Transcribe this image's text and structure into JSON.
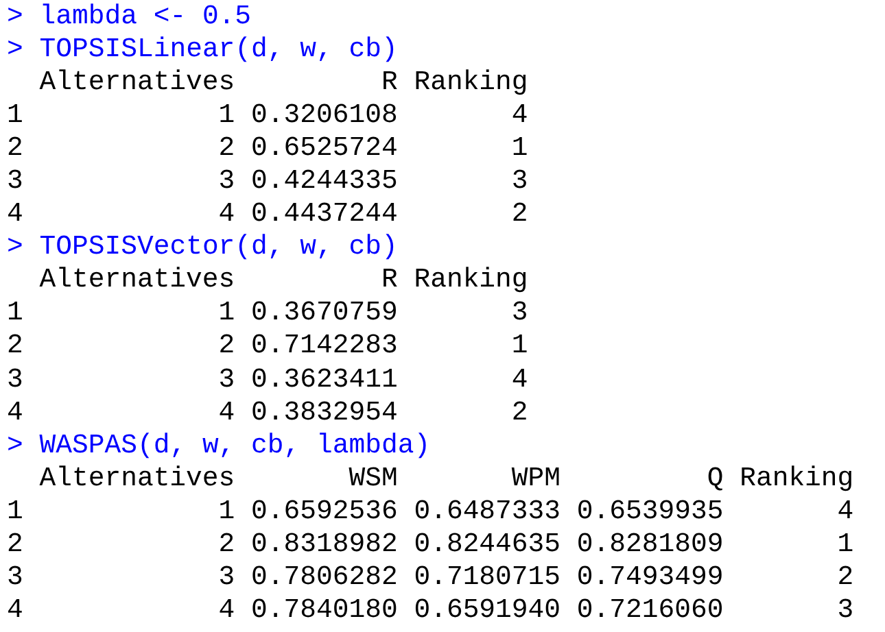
{
  "console": [
    {
      "kind": "command",
      "prompt": ">",
      "text": "lambda <- 0.5"
    },
    {
      "kind": "command",
      "prompt": ">",
      "text": "TOPSISLinear(d, w, cb)"
    },
    {
      "kind": "table",
      "columns": [
        "Alternatives",
        "R",
        "Ranking"
      ],
      "rows": [
        {
          "label": "1",
          "cells": [
            "1",
            "0.3206108",
            "4"
          ]
        },
        {
          "label": "2",
          "cells": [
            "2",
            "0.6525724",
            "1"
          ]
        },
        {
          "label": "3",
          "cells": [
            "3",
            "0.4244335",
            "3"
          ]
        },
        {
          "label": "4",
          "cells": [
            "4",
            "0.4437244",
            "2"
          ]
        }
      ]
    },
    {
      "kind": "command",
      "prompt": ">",
      "text": "TOPSISVector(d, w, cb)"
    },
    {
      "kind": "table",
      "columns": [
        "Alternatives",
        "R",
        "Ranking"
      ],
      "rows": [
        {
          "label": "1",
          "cells": [
            "1",
            "0.3670759",
            "3"
          ]
        },
        {
          "label": "2",
          "cells": [
            "2",
            "0.7142283",
            "1"
          ]
        },
        {
          "label": "3",
          "cells": [
            "3",
            "0.3623411",
            "4"
          ]
        },
        {
          "label": "4",
          "cells": [
            "4",
            "0.3832954",
            "2"
          ]
        }
      ]
    },
    {
      "kind": "command",
      "prompt": ">",
      "text": "WASPAS(d, w, cb, lambda)"
    },
    {
      "kind": "table",
      "columns": [
        "Alternatives",
        "WSM",
        "WPM",
        "Q",
        "Ranking"
      ],
      "rows": [
        {
          "label": "1",
          "cells": [
            "1",
            "0.6592536",
            "0.6487333",
            "0.6539935",
            "4"
          ]
        },
        {
          "label": "2",
          "cells": [
            "2",
            "0.8318982",
            "0.8244635",
            "0.8281809",
            "1"
          ]
        },
        {
          "label": "3",
          "cells": [
            "3",
            "0.7806282",
            "0.7180715",
            "0.7493499",
            "2"
          ]
        },
        {
          "label": "4",
          "cells": [
            "4",
            "0.7840180",
            "0.6591940",
            "0.7216060",
            "3"
          ]
        }
      ]
    }
  ]
}
